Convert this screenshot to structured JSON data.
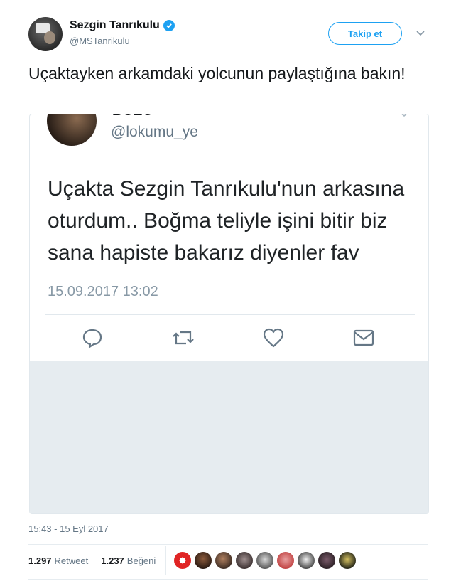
{
  "author": {
    "name": "Sezgin Tanrıkulu",
    "handle": "@MSTanrikulu",
    "verified_icon": "verified-badge-icon"
  },
  "follow_label": "Takip et",
  "tweet_text": "Uçaktayken arkamdaki yolcunun paylaştığına bakın!",
  "embedded": {
    "name": "BOZO",
    "handle": "@lokumu_ye",
    "text": "Uçakta Sezgin Tanrıkulu'nun arkasına oturdum.. Boğma teliyle işini bitir biz sana hapiste bakarız diyenler fav",
    "date": "15.09.2017 13:02",
    "actions": [
      "reply-icon",
      "retweet-icon",
      "like-icon",
      "message-icon"
    ]
  },
  "timestamp": "15:43 - 15 Eyl 2017",
  "stats": {
    "retweet_count": "1.297",
    "retweet_label": "Retweet",
    "like_count": "1.237",
    "like_label": "Beğeni"
  },
  "colors": {
    "accent": "#1da1f2",
    "text": "#14171a",
    "muted": "#657786"
  },
  "liker_avatars": 10
}
